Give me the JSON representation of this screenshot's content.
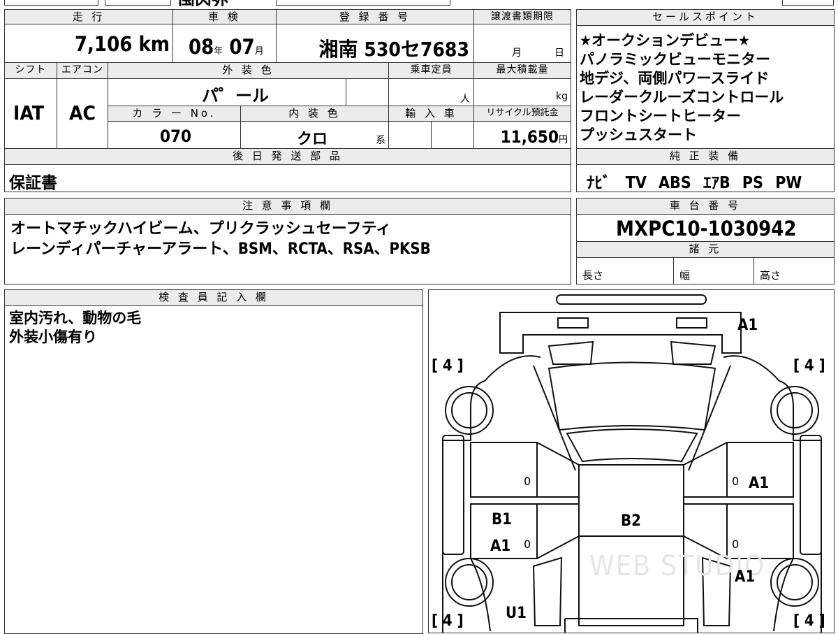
{
  "top_strip": {
    "fragment": "国内外"
  },
  "specs": {
    "mileage_label": "走 行",
    "mileage": "7,106",
    "mileage_unit": "km",
    "inspection_label": "車 検",
    "inspection_year": "08",
    "year_unit": "年",
    "inspection_month": "07",
    "month_unit": "月",
    "registration_label": "登 録 番 号",
    "registration": "湘南 530セ7683",
    "transfer_label": "譲渡書類期限",
    "transfer_month_unit": "月",
    "transfer_day_unit": "日",
    "shift_label": "シフト",
    "shift": "IAT",
    "aircon_label": "エアコン",
    "aircon": "AC",
    "exterior_color_label": "外 装 色",
    "exterior_color": "パ゜ール",
    "capacity_label": "乗車定員",
    "capacity_unit": "人",
    "max_load_label": "最大積載量",
    "max_load_unit": "kg",
    "color_no_label": "カ ラ ー No.",
    "color_no": "070",
    "interior_color_label": "内 装 色",
    "interior_color": "クロ",
    "interior_suffix": "系",
    "import_label": "輸 入 車",
    "recycle_label": "リサイクル預託金",
    "recycle_fee": "11,650",
    "recycle_unit": "円"
  },
  "parts": {
    "label": "後 日 発 送 部 品",
    "value": "保証書"
  },
  "sales_points": {
    "label": "セールスポイント",
    "lines": [
      "★オークションデビュー★",
      "パノラミックビューモニター",
      "地デジ、両側パワースライド",
      "レーダークルーズコントロール",
      "フロントシートヒーター",
      "プッシュスタート"
    ]
  },
  "equipment": {
    "label": "純 正 装 備",
    "items": [
      "ﾅﾋﾞ",
      "TV",
      "ABS",
      "ｴｱB",
      "PS",
      "PW"
    ]
  },
  "notes": {
    "label": "注 意 事 項 欄",
    "lines": [
      "オートマチックハイビーム、プリクラッシュセーフティ",
      "レーンディパーチャーアラート、BSM、RCTA、RSA、PKSB"
    ]
  },
  "chassis": {
    "label": "車 台 番 号",
    "value": "MXPC10-1030942"
  },
  "dimensions": {
    "label": "諸 元",
    "length_label": "長さ",
    "width_label": "幅",
    "height_label": "高さ"
  },
  "inspector": {
    "label": "検 査 員 記 入 欄",
    "lines": [
      "室内汚れ、動物の毛",
      "外装小傷有り"
    ]
  },
  "diagram": {
    "tire_front_left": "[ 4 ]",
    "tire_front_right": "[ 4 ]",
    "tire_rear_left": "[ 4 ]",
    "tire_rear_right": "[ 4 ]",
    "marks": {
      "front_bumper": "A1",
      "right_front_door": "A1",
      "right_rear_door": "A1",
      "left_front_door": "B1",
      "left_rear_door": "A1",
      "roof": "B2",
      "left_rear_quarter": "U1"
    },
    "zero": "0",
    "watermark": "WEB STUDIO"
  }
}
